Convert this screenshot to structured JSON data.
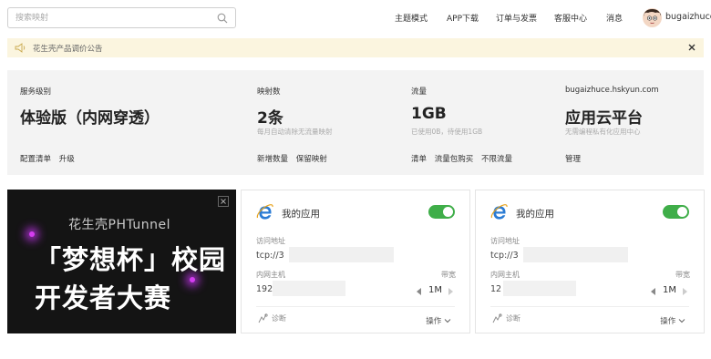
{
  "search": {
    "placeholder": "搜索映射"
  },
  "nav": [
    "主题模式",
    "APP下载",
    "订单与发票",
    "客服中心",
    "消息"
  ],
  "user": {
    "name": "bugaizhuce"
  },
  "notice": {
    "text": "花生壳产品调价公告"
  },
  "summary": {
    "service": {
      "label": "服务级别",
      "value": "体验版（内网穿透）",
      "links": [
        "配置清单",
        "升级"
      ]
    },
    "mappings": {
      "label": "映射数",
      "value": "2条",
      "note": "每月自动清除无流量映射",
      "links": [
        "新增数量",
        "保留映射"
      ]
    },
    "traffic": {
      "label": "流量",
      "value": "1GB",
      "note": "已使用0B，待使用1GB",
      "links": [
        "清单",
        "流量包购买",
        "不限流量"
      ]
    },
    "domain": {
      "label": "bugaizhuce.hskyun.com",
      "value": "应用云平台",
      "note": "无需编程私有化应用中心",
      "links": [
        "管理"
      ]
    }
  },
  "banner": {
    "title": "花生壳PHTunnel",
    "line1": "「梦想杯」校园",
    "line2": "开发者大赛"
  },
  "apps": [
    {
      "title": "我的应用",
      "access_label": "访问地址",
      "access_value": "tcp://3",
      "host_label": "内网主机",
      "host_value": "192",
      "bw_label": "带宽",
      "bw_value": "1M",
      "diag": "诊断",
      "ops": "操作"
    },
    {
      "title": "我的应用",
      "access_label": "访问地址",
      "access_value": "tcp://3",
      "host_label": "内网主机",
      "host_value": "12",
      "bw_label": "带宽",
      "bw_value": "1M",
      "diag": "诊断",
      "ops": "操作"
    }
  ],
  "colors": {
    "accent_green": "#3fae49",
    "notice_bg": "#fbf5df",
    "panel_bg": "#f3f3f3",
    "ie_blue": "#2a7bd4"
  },
  "icons": [
    "search-icon",
    "speaker-icon",
    "close-icon",
    "ie-icon",
    "diagnose-icon",
    "chevron-down-icon"
  ]
}
